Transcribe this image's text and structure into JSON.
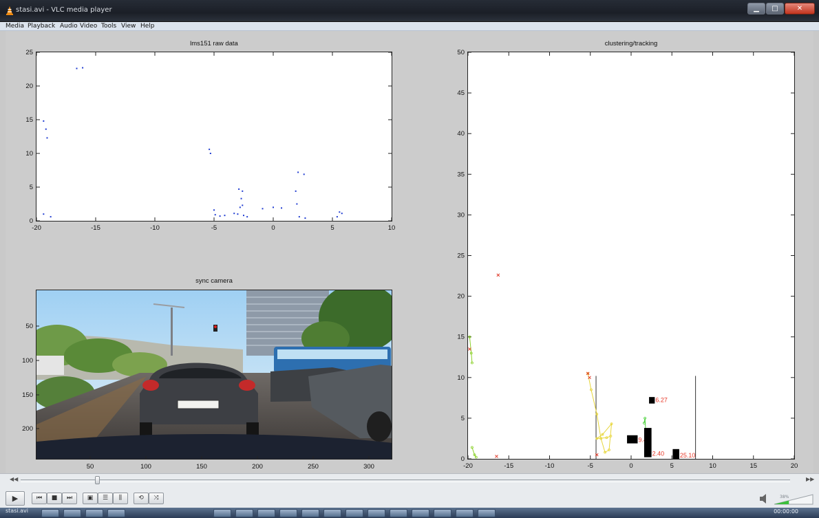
{
  "window": {
    "title": "stasi.avi - VLC media player"
  },
  "menu": [
    "Media",
    "Playback",
    "Audio",
    "Video",
    "Tools",
    "View",
    "Help"
  ],
  "icons": {
    "app": "vlc-cone-icon",
    "minimize": "minimize-icon",
    "maximize": "maximize-icon",
    "close": "close-icon",
    "play": "play-icon",
    "prev": "previous-icon",
    "stop": "stop-icon",
    "next": "next-icon",
    "fullscreen": "fullscreen-icon",
    "playlist": "playlist-icon",
    "extended": "extended-settings-icon",
    "loop": "loop-icon",
    "shuffle": "shuffle-icon",
    "speaker": "speaker-icon",
    "seek_back": "seek-back-icon",
    "seek_forward": "seek-forward-icon"
  },
  "plots": {
    "raw": {
      "title": "lms151 raw data",
      "xlim": [
        -20,
        10
      ],
      "ylim": [
        0,
        25
      ],
      "xticks": [
        -20,
        -15,
        -10,
        -5,
        0,
        5,
        10
      ],
      "yticks": [
        0,
        5,
        10,
        15,
        20,
        25
      ]
    },
    "tracking": {
      "title": "clustering/tracking",
      "xlim": [
        -20,
        20
      ],
      "ylim": [
        0,
        50
      ],
      "xticks": [
        -20,
        -15,
        -10,
        -5,
        0,
        5,
        10,
        15,
        20
      ],
      "yticks": [
        0,
        5,
        10,
        15,
        20,
        25,
        30,
        35,
        40,
        45,
        50
      ]
    },
    "camera": {
      "title": "sync camera",
      "xticks": [
        50,
        100,
        150,
        200,
        250,
        300
      ],
      "yticks": [
        50,
        100,
        150,
        200
      ]
    }
  },
  "chart_data": [
    {
      "type": "scatter",
      "title": "lms151 raw data",
      "xlim": [
        -20,
        10
      ],
      "ylim": [
        0,
        25
      ],
      "series": [
        {
          "color": "#1f3bd1",
          "points": [
            [
              -19.4,
              14.8
            ],
            [
              -19.2,
              13.6
            ],
            [
              -19.1,
              12.3
            ],
            [
              -19.4,
              1.0
            ],
            [
              -18.8,
              0.6
            ],
            [
              -16.6,
              22.6
            ],
            [
              -16.1,
              22.7
            ],
            [
              -5.4,
              10.6
            ],
            [
              -5.3,
              10.0
            ],
            [
              -5.0,
              1.6
            ],
            [
              -4.9,
              0.9
            ],
            [
              -4.5,
              0.7
            ],
            [
              -4.1,
              0.8
            ],
            [
              -3.3,
              1.1
            ],
            [
              -3.0,
              1.0
            ],
            [
              -2.8,
              2.0
            ],
            [
              -2.6,
              2.3
            ],
            [
              -2.7,
              3.3
            ],
            [
              -2.6,
              4.4
            ],
            [
              -2.9,
              4.7
            ],
            [
              -2.5,
              0.8
            ],
            [
              -2.2,
              0.6
            ],
            [
              -0.9,
              1.8
            ],
            [
              0.0,
              2.0
            ],
            [
              0.7,
              1.9
            ],
            [
              1.9,
              4.4
            ],
            [
              2.0,
              2.5
            ],
            [
              2.2,
              0.6
            ],
            [
              2.7,
              0.4
            ],
            [
              2.1,
              7.2
            ],
            [
              2.6,
              6.9
            ],
            [
              5.4,
              0.6
            ],
            [
              5.6,
              1.3
            ],
            [
              5.8,
              1.1
            ]
          ]
        }
      ]
    },
    {
      "type": "scatter",
      "title": "clustering/tracking",
      "xlim": [
        -20,
        20
      ],
      "ylim": [
        0,
        50
      ],
      "markers": {
        "color": "#e03a2a",
        "points": [
          [
            -16.3,
            22.6
          ],
          [
            -19.8,
            13.5
          ],
          [
            -5.3,
            10.5
          ],
          [
            -5.1,
            10.0
          ],
          [
            -16.5,
            0.3
          ],
          [
            -4.2,
            0.5
          ]
        ]
      },
      "blocks": [
        {
          "x": [
            2.2,
            2.9
          ],
          "y": [
            6.8,
            7.6
          ],
          "label": "6.27"
        },
        {
          "x": [
            -0.5,
            0.8
          ],
          "y": [
            1.9,
            2.9
          ],
          "label": "9.40"
        },
        {
          "x": [
            1.6,
            2.5
          ],
          "y": [
            0.2,
            3.8
          ],
          "label": "2.40"
        },
        {
          "x": [
            5.1,
            5.9
          ],
          "y": [
            0.0,
            1.2
          ],
          "label": "25.10"
        }
      ],
      "vlines": [
        {
          "x": -4.3,
          "y": [
            0,
            10.2
          ]
        },
        {
          "x": 7.9,
          "y": [
            0,
            10.2
          ]
        }
      ],
      "tracks": [
        {
          "color": "#8bd12a",
          "points": [
            [
              -19.8,
              15.0
            ],
            [
              -19.6,
              13.0
            ],
            [
              -19.5,
              11.8
            ]
          ]
        },
        {
          "color": "#8bd12a",
          "points": [
            [
              -19.5,
              1.4
            ],
            [
              -19.2,
              0.5
            ],
            [
              -19.0,
              0.2
            ]
          ]
        },
        {
          "color": "#e7d63a",
          "points": [
            [
              -5.3,
              10.5
            ],
            [
              -4.9,
              8.5
            ],
            [
              -4.2,
              5.5
            ],
            [
              -3.7,
              2.5
            ],
            [
              -3.2,
              0.8
            ],
            [
              -2.7,
              1.1
            ],
            [
              -2.4,
              4.3
            ],
            [
              -3.5,
              3.0
            ],
            [
              -4.2,
              2.5
            ],
            [
              -3.0,
              2.6
            ],
            [
              -2.5,
              2.8
            ]
          ]
        },
        {
          "color": "#4bd13b",
          "points": [
            [
              1.6,
              4.4
            ],
            [
              1.7,
              5.0
            ],
            [
              1.8,
              3.2
            ]
          ]
        }
      ]
    }
  ],
  "controls": {
    "volume_percent_label": "38%",
    "volume_level": 0.38,
    "seek_position": 0.1
  },
  "status": {
    "left": "stasi.avi",
    "time": "00:00:00"
  }
}
